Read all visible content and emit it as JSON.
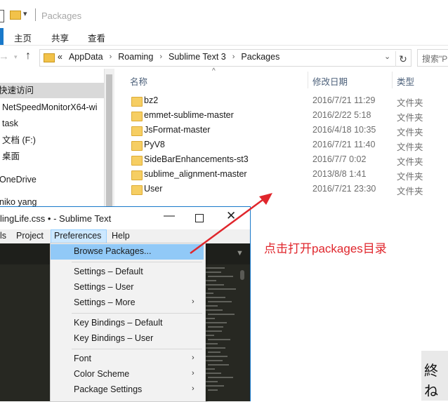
{
  "explorer": {
    "window_title": "Packages",
    "ribbon_tabs": [
      "主页",
      "共享",
      "查看"
    ],
    "breadcrumbs": [
      "AppData",
      "Roaming",
      "Sublime Text 3",
      "Packages"
    ],
    "breadcrumb_prefix": "«",
    "search_placeholder": "搜索\"P",
    "nav_items": [
      "快速访问",
      "NetSpeedMonitorX64-wi",
      "task",
      "文档 (F:)",
      "桌面",
      "OneDrive",
      "niko yang"
    ],
    "columns": {
      "name": "名称",
      "date": "修改日期",
      "type": "类型"
    },
    "files": [
      {
        "name": "bz2",
        "date": "2016/7/21 11:29",
        "type": "文件夹"
      },
      {
        "name": "emmet-sublime-master",
        "date": "2016/2/22 5:18",
        "type": "文件夹"
      },
      {
        "name": "JsFormat-master",
        "date": "2016/4/18 10:35",
        "type": "文件夹"
      },
      {
        "name": "PyV8",
        "date": "2016/7/21 11:40",
        "type": "文件夹"
      },
      {
        "name": "SideBarEnhancements-st3",
        "date": "2016/7/7 0:02",
        "type": "文件夹"
      },
      {
        "name": "sublime_alignment-master",
        "date": "2013/8/8 1:41",
        "type": "文件夹"
      },
      {
        "name": "User",
        "date": "2016/7/21 23:30",
        "type": "文件夹"
      }
    ]
  },
  "sublime": {
    "title": "lingLife.css • - Sublime Text",
    "menu": [
      "ls",
      "Project",
      "Preferences",
      "Help"
    ],
    "dropdown": [
      {
        "label": "Browse Packages...",
        "submenu": false,
        "highlighted": true
      },
      {
        "label": "Settings – Default",
        "submenu": false
      },
      {
        "label": "Settings – User",
        "submenu": false
      },
      {
        "label": "Settings – More",
        "submenu": true
      },
      {
        "label": "Key Bindings – Default",
        "submenu": false
      },
      {
        "label": "Key Bindings – User",
        "submenu": false
      },
      {
        "label": "Font",
        "submenu": true
      },
      {
        "label": "Color Scheme",
        "submenu": true
      },
      {
        "label": "Package Settings",
        "submenu": true
      }
    ]
  },
  "annotation": {
    "text": "点击打开packages目录",
    "color": "#e0262c"
  },
  "corner_text": "終ね"
}
